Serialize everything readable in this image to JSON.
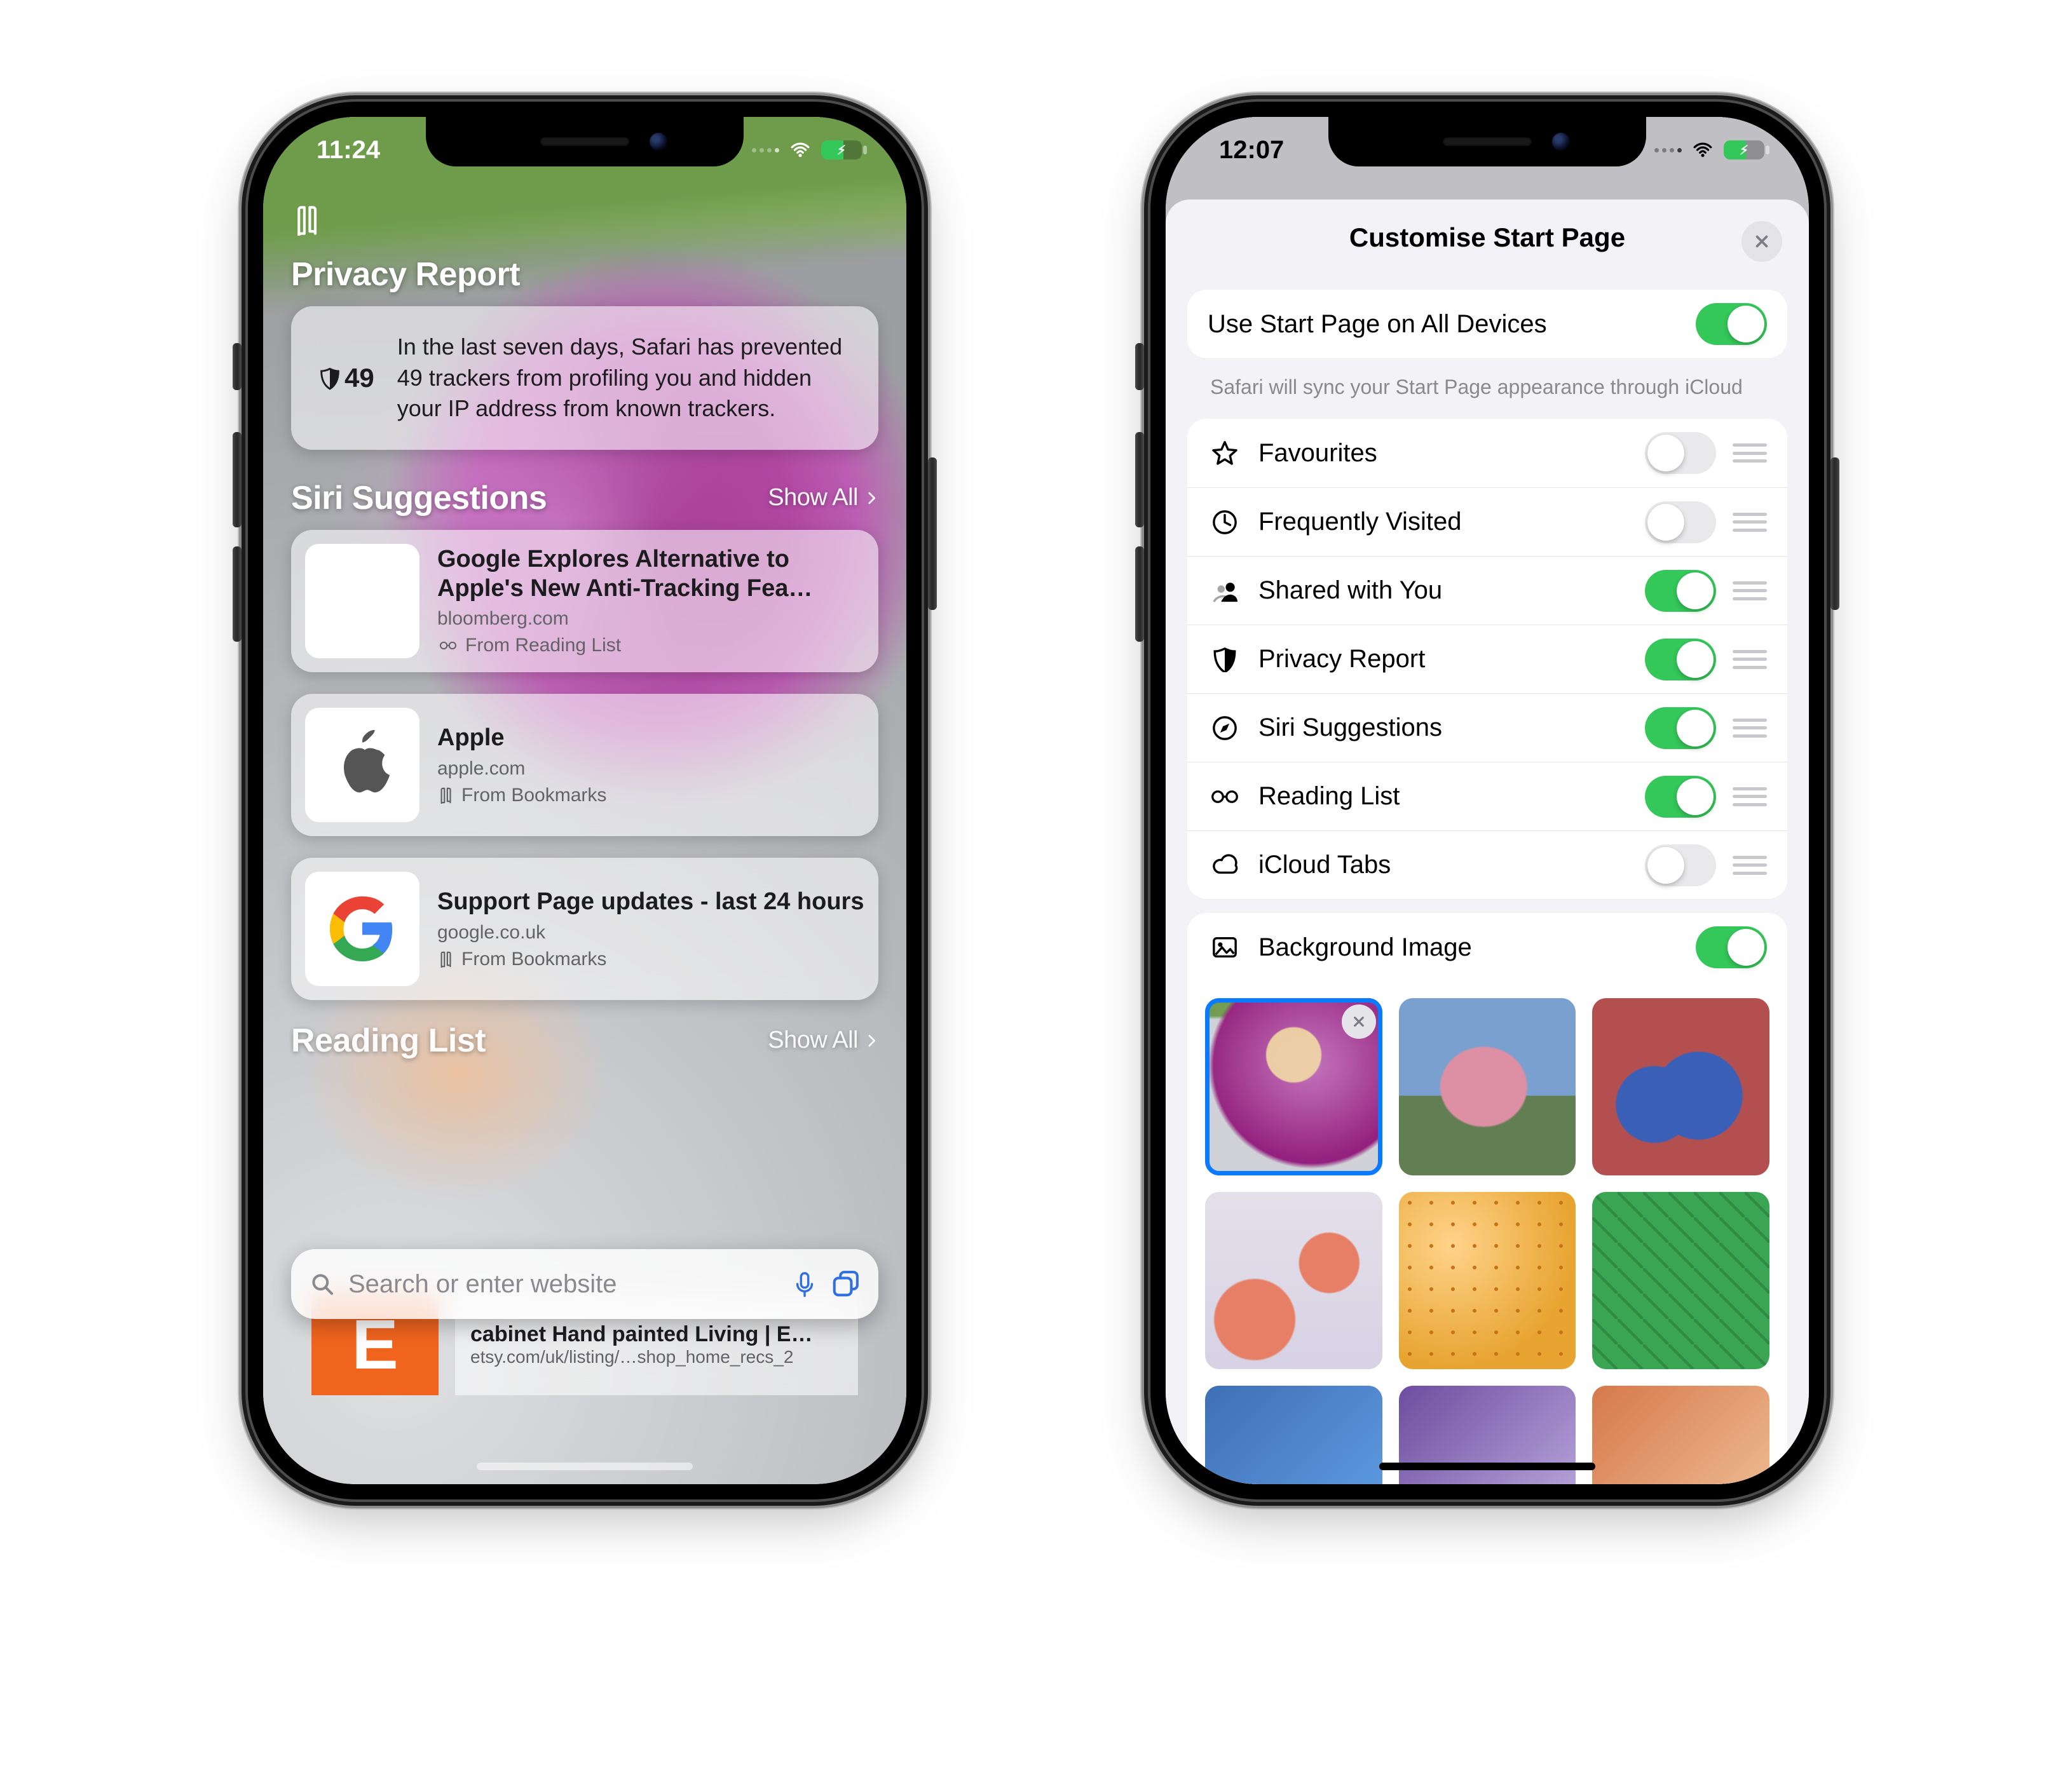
{
  "left": {
    "status": {
      "time": "11:24"
    },
    "sections": {
      "privacy": {
        "title": "Privacy Report",
        "count": "49",
        "summary": "In the last seven days, Safari has prevented 49 trackers from profiling you and hidden your IP address from known trackers."
      },
      "siri": {
        "title": "Siri Suggestions",
        "show_all": "Show All",
        "items": [
          {
            "title": "Google Explores Alternative to Apple's New Anti-Tracking Fea…",
            "domain": "bloomberg.com",
            "from": "From Reading List",
            "from_icon": "glasses-icon"
          },
          {
            "title": "Apple",
            "domain": "apple.com",
            "from": "From Bookmarks",
            "from_icon": "book-icon"
          },
          {
            "title": "Support Page updates - last 24 hours",
            "domain": "google.co.uk",
            "from": "From Bookmarks",
            "from_icon": "book-icon"
          }
        ]
      },
      "reading_list": {
        "title": "Reading List",
        "show_all": "Show All",
        "item": {
          "title": "cabinet Hand painted Living | E…",
          "domain": "etsy.com/uk/listing/…shop_home_recs_2",
          "badge": "E"
        }
      }
    },
    "addr": {
      "placeholder": "Search or enter website"
    }
  },
  "right": {
    "status": {
      "time": "12:07"
    },
    "sheet": {
      "title": "Customise Start Page",
      "sync": {
        "label": "Use Start Page on All Devices",
        "on": true
      },
      "foot": "Safari will sync your Start Page appearance through iCloud",
      "sections": [
        {
          "icon": "star-icon",
          "label": "Favourites",
          "on": false
        },
        {
          "icon": "clock-icon",
          "label": "Frequently Visited",
          "on": false
        },
        {
          "icon": "people-icon",
          "label": "Shared with You",
          "on": true
        },
        {
          "icon": "shield-icon",
          "label": "Privacy Report",
          "on": true
        },
        {
          "icon": "compass-icon",
          "label": "Siri Suggestions",
          "on": true
        },
        {
          "icon": "glasses-icon",
          "label": "Reading List",
          "on": true
        },
        {
          "icon": "cloud-icon",
          "label": "iCloud Tabs",
          "on": false
        }
      ],
      "bg": {
        "label": "Background Image",
        "on": true
      }
    }
  }
}
